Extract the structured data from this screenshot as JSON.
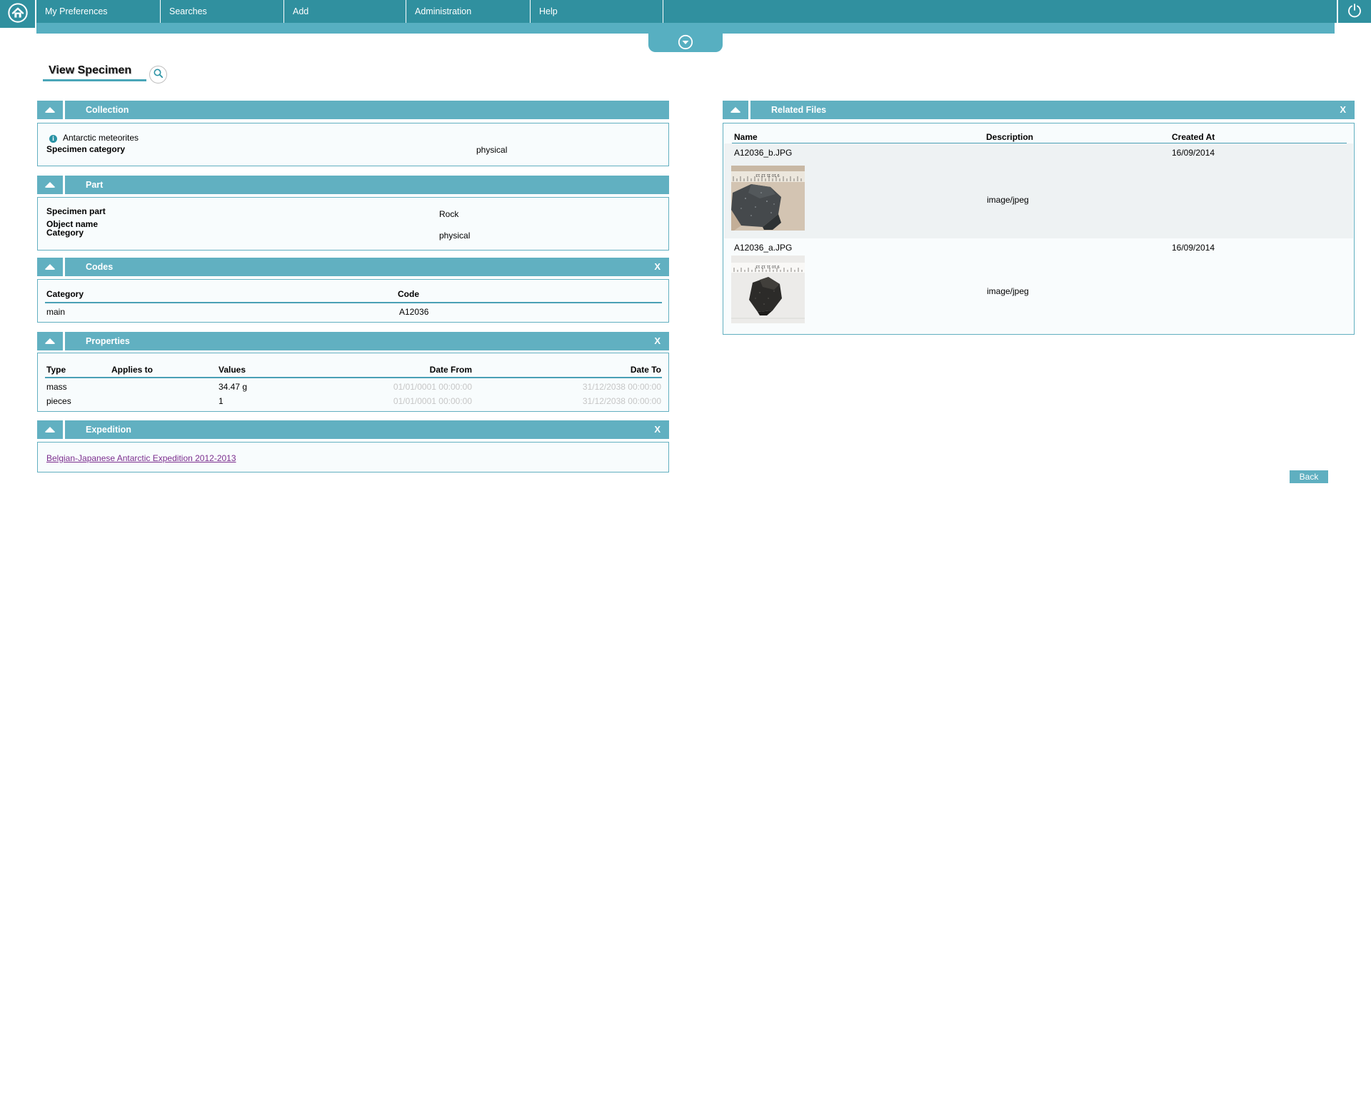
{
  "nav": {
    "items": [
      "My Preferences",
      "Searches",
      "Add",
      "Administration",
      "Help"
    ]
  },
  "page_title": "View Specimen",
  "close_label": "X",
  "collection": {
    "title": "Collection",
    "info": "Antarctic meteorites",
    "label": "Specimen category",
    "value": "physical"
  },
  "part": {
    "title": "Part",
    "rows": [
      {
        "label": "Specimen part",
        "value": "Rock"
      },
      {
        "label": "Object name",
        "value": ""
      },
      {
        "label": "Category",
        "value": "physical"
      }
    ]
  },
  "codes": {
    "title": "Codes",
    "columns": [
      "Category",
      "Code"
    ],
    "rows": [
      [
        "main",
        "A12036"
      ]
    ]
  },
  "properties": {
    "title": "Properties",
    "columns": [
      "Type",
      "Applies to",
      "Values",
      "Date From",
      "Date To"
    ],
    "rows": [
      [
        "mass",
        "",
        "34.47 g",
        "01/01/0001 00:00:00",
        "31/12/2038 00:00:00"
      ],
      [
        "pieces",
        "",
        "1",
        "01/01/0001 00:00:00",
        "31/12/2038 00:00:00"
      ]
    ]
  },
  "expedition": {
    "title": "Expedition",
    "link": "Belgian-Japanese Antarctic Expedition 2012-2013"
  },
  "related_files": {
    "title": "Related Files",
    "columns": [
      "Name",
      "Description",
      "Created At"
    ],
    "rows": [
      {
        "name": "A12036_b.JPG",
        "description": "image/jpeg",
        "created": "16/09/2014"
      },
      {
        "name": "A12036_a.JPG",
        "description": "image/jpeg",
        "created": "16/09/2014"
      }
    ]
  },
  "back_label": "Back",
  "colors": {
    "teal_dark": "#30909f",
    "teal_light": "#57afc1",
    "panel_header": "#61b0c1",
    "panel_body": "#f8fcfd",
    "link_purple": "#7b2e8e",
    "muted_date": "#c6c6c6"
  }
}
